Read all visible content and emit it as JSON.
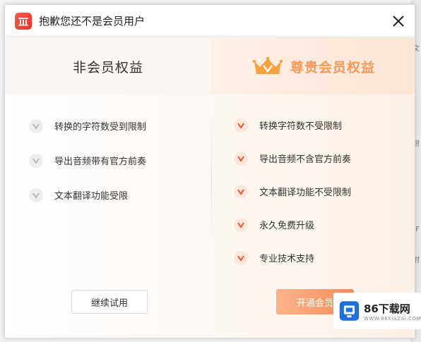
{
  "window": {
    "title": "抱歉您还不是会员用户"
  },
  "background_app": {
    "side_chars": [
      "文",
      "厨",
      "F",
      "附"
    ]
  },
  "columns": {
    "free": {
      "header": "非会员权益",
      "items": [
        "转换的字符数受到限制",
        "导出音频带有官方前奏",
        "文本翻译功能受限"
      ]
    },
    "vip": {
      "header": "尊贵会员权益",
      "items": [
        "转换字符数不受限制",
        "导出音频不含官方前奏",
        "文本翻译功能不受限制",
        "永久免费升级",
        "专业技术支持"
      ]
    }
  },
  "buttons": {
    "trial": "继续试用",
    "open_vip": "开通会员"
  },
  "watermark": {
    "name": "86下载网",
    "url": "WWW.86XIAZAI.COM"
  },
  "colors": {
    "accent": "#f58e5a",
    "crown": "#f7a23c",
    "check_orange": "#e8542f",
    "logo_red": "#e0342a"
  }
}
